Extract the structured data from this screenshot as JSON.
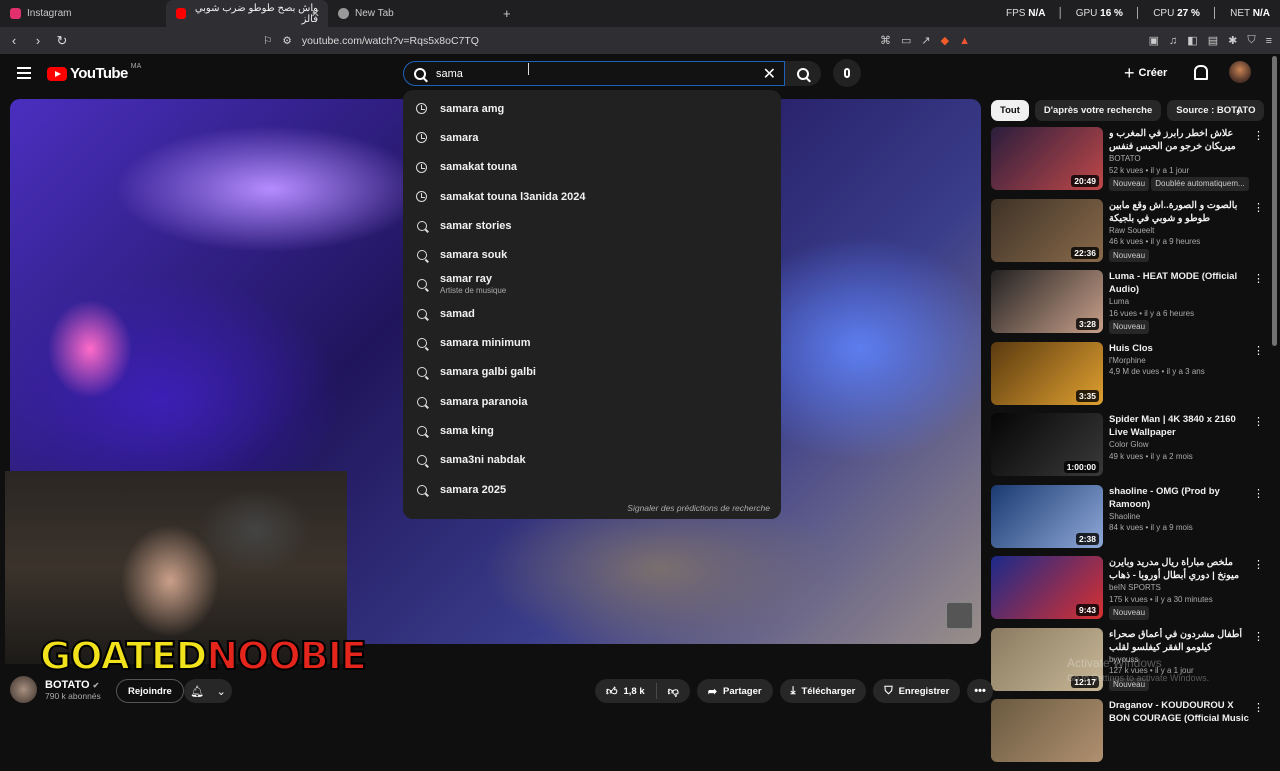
{
  "browser": {
    "tabs": [
      {
        "label": "Instagram",
        "color": "#e1306c"
      },
      {
        "label": "واش بصح طوطو ضرب شوبي فالز",
        "color": "#ff0000"
      },
      {
        "label": "New Tab",
        "color": "#999999"
      }
    ],
    "new_tab": "+",
    "stats": {
      "fps_label": "FPS",
      "fps": "N/A",
      "gpu_label": "GPU",
      "gpu": "16 %",
      "cpu_label": "CPU",
      "cpu": "27 %",
      "net_label": "NET",
      "net": "N/A"
    },
    "url": "youtube.com/watch?v=Rqs5x8oC7TQ"
  },
  "youtube": {
    "logo_text": "YouTube",
    "region": "MA",
    "search_value": "sama",
    "create_label": "Créer",
    "suggestions": [
      {
        "text": "samara amg",
        "type": "history"
      },
      {
        "text": "samara",
        "type": "history"
      },
      {
        "text": "samakat touna",
        "type": "history"
      },
      {
        "text": "samakat touna l3anida 2024",
        "type": "history"
      },
      {
        "text": "samar stories",
        "type": "search"
      },
      {
        "text": "samara souk",
        "type": "search"
      },
      {
        "text": "samar ray",
        "type": "search",
        "sub": "Artiste de musique"
      },
      {
        "text": "samad",
        "type": "search"
      },
      {
        "text": "samara minimum",
        "type": "search"
      },
      {
        "text": "samara galbi galbi",
        "type": "search"
      },
      {
        "text": "samara paranoia",
        "type": "search"
      },
      {
        "text": "sama king",
        "type": "search"
      },
      {
        "text": "sama3ni nabdak",
        "type": "search"
      },
      {
        "text": "samara 2025",
        "type": "search"
      }
    ],
    "report_label": "Signaler des prédictions de recherche"
  },
  "video": {
    "overlay_text_1": "GOATED",
    "overlay_text_2": "NOOBIE",
    "channel": "BOTATO",
    "subscribers": "790 k abonnés",
    "join_label": "Rejoindre",
    "likes": "1,8 k",
    "share_label": "Partager",
    "download_label": "Télécharger",
    "save_label": "Enregistrer"
  },
  "sidebar": {
    "chips": [
      "Tout",
      "D'après votre recherche",
      "Source : BOTATO"
    ],
    "recommendations": [
      {
        "title": "علاش اخطر رابرز في المغرب و ميريكان خرجو من الحبس فنفس الوقت؟",
        "channel": "BOTATO",
        "meta": "52 k vues • il y a 1 jour",
        "badge": "Nouveau",
        "extra": "Doublée automatiquem...",
        "duration": "20:49",
        "c1": "#2a1d3d",
        "c2": "#c04848"
      },
      {
        "title": "بالصوت و الصورة..اش وقع مابين طوطو و شوبي في بلجيكة",
        "channel": "Raw Soueelt",
        "meta": "46 k vues • il y a 9 heures",
        "badge": "Nouveau",
        "extra": "",
        "duration": "22:36",
        "c1": "#3d3227",
        "c2": "#8a6a4a"
      },
      {
        "title": "Luma - HEAT MODE (Official Audio)",
        "channel": "Luma",
        "meta": "16 vues • il y a 6 heures",
        "badge": "Nouveau",
        "extra": "",
        "duration": "3:28",
        "c1": "#222222",
        "c2": "#c9a08a"
      },
      {
        "title": "Huis Clos",
        "channel": "l'Morphine",
        "meta": "4,9 M de vues • il y a 3 ans",
        "badge": "",
        "extra": "",
        "duration": "3:35",
        "c1": "#5a3a10",
        "c2": "#e0a030"
      },
      {
        "title": "Spider Man | 4K 3840 x 2160 Live Wallpaper",
        "channel": "Color Glow",
        "meta": "49 k vues • il y a 2 mois",
        "badge": "",
        "extra": "",
        "duration": "1:00:00",
        "c1": "#050505",
        "c2": "#3a3a3a"
      },
      {
        "title": "shaoline - OMG (Prod by Ramoon)",
        "channel": "Shaoline",
        "meta": "84 k vues • il y a 9 mois",
        "badge": "",
        "extra": "",
        "duration": "2:38",
        "c1": "#1a3a70",
        "c2": "#8fa8d8"
      },
      {
        "title": "ملخص مباراة ريال مدريد وبايرن ميونخ | دوري أبطال أوروبا - ذهاب الدور ربع ...",
        "channel": "beIN SPORTS",
        "meta": "175 k vues • il y a 30 minutes",
        "badge": "Nouveau",
        "extra": "",
        "duration": "9:43",
        "c1": "#1a2a8a",
        "c2": "#d83030"
      },
      {
        "title": "أطفال مشردون في أعماق صحراء كيلومو الفقر كيفلسو لقلب",
        "channel": "byyouss",
        "meta": "127 k vues • il y a 1 jour",
        "badge": "Nouveau",
        "extra": "",
        "duration": "12:17",
        "c1": "#8a7a60",
        "c2": "#c8b898"
      },
      {
        "title": "Draganov - KOUDOUROU X BON COURAGE (Official Music Video)",
        "channel": "",
        "meta": "",
        "badge": "",
        "extra": "",
        "duration": "",
        "c1": "#6a5a40",
        "c2": "#b09070"
      }
    ]
  },
  "watermark": {
    "line1": "Activate Windows",
    "line2": "Go to Settings to activate Windows."
  }
}
